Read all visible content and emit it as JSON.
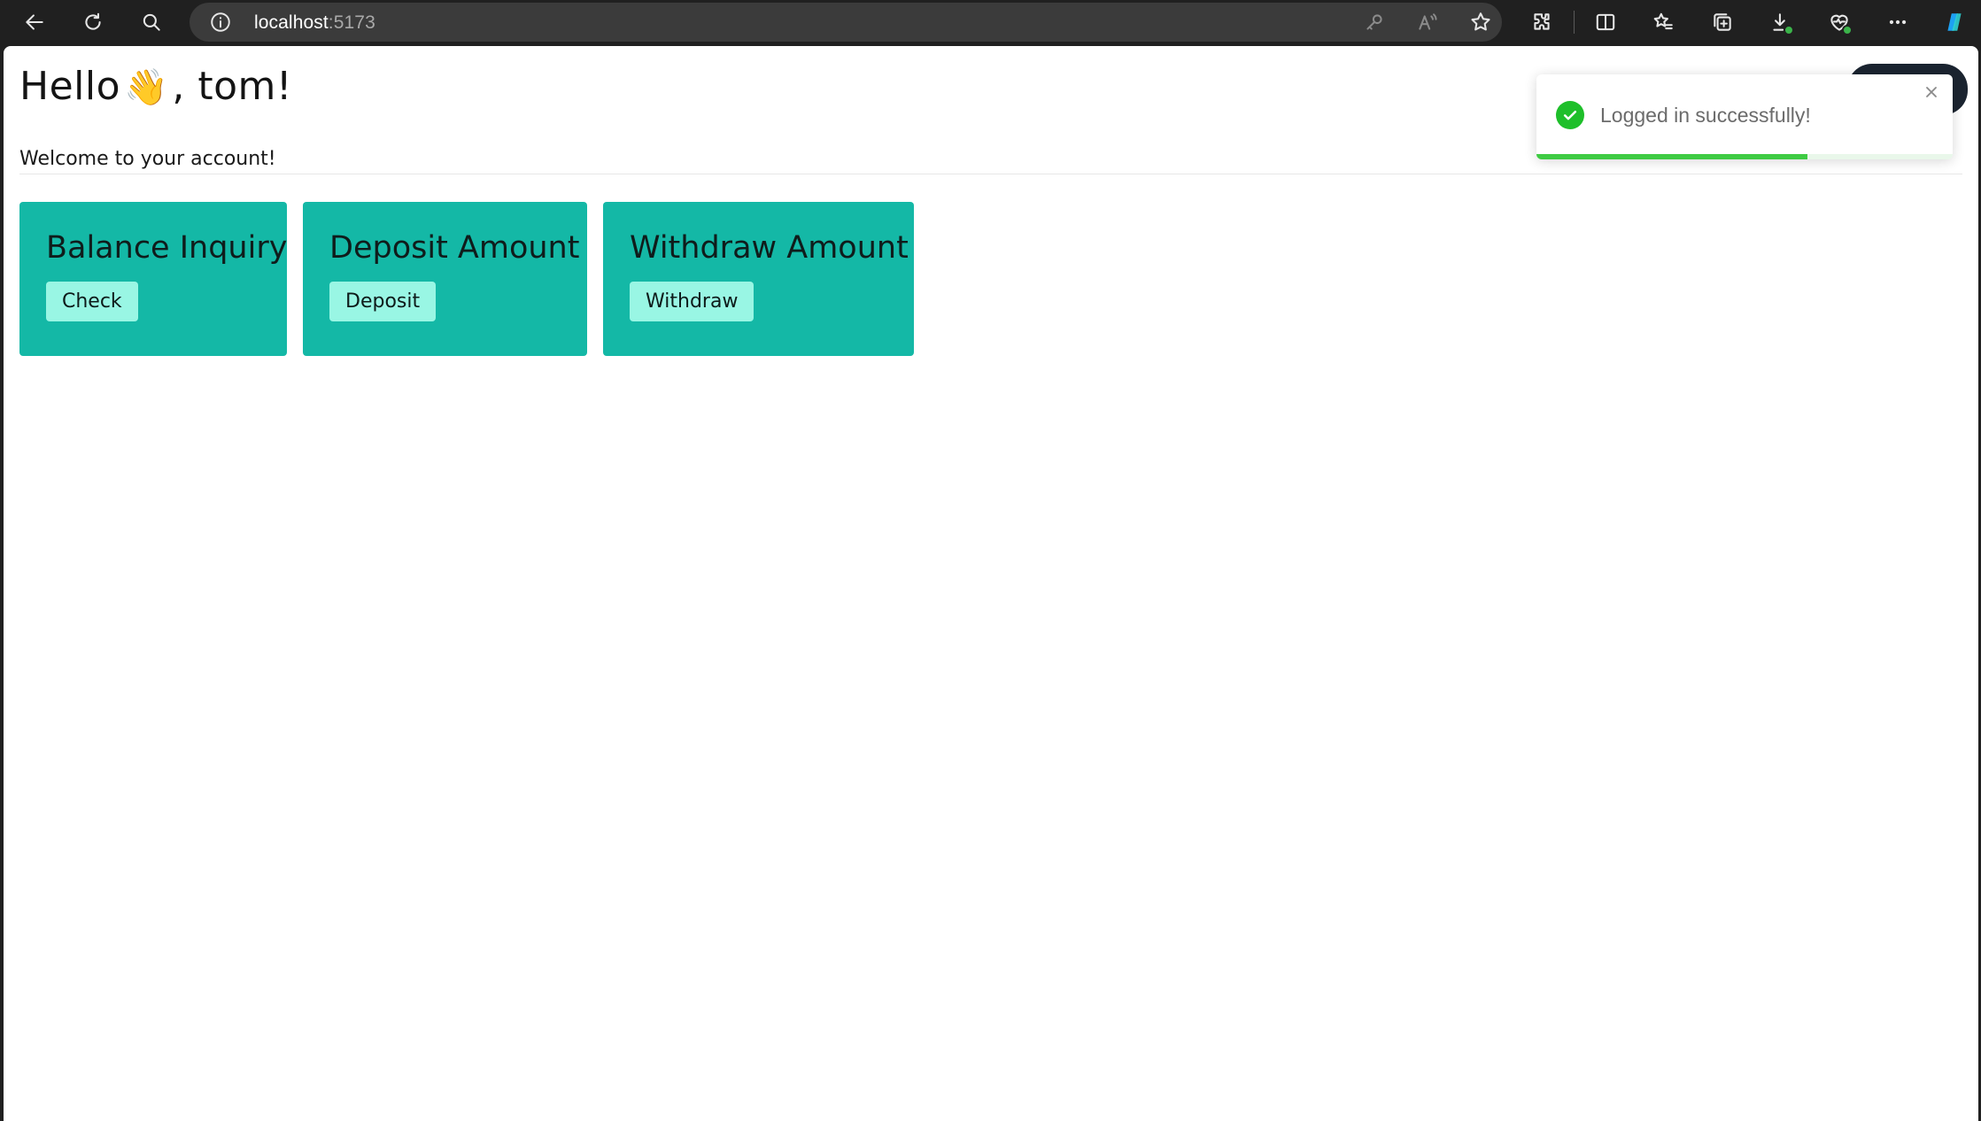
{
  "browser": {
    "url_host": "localhost",
    "url_port": ":5173",
    "icons": [
      "back-icon",
      "refresh-icon",
      "search-icon",
      "info-icon",
      "key-icon",
      "read-aloud-icon",
      "favorite-star-icon",
      "extensions-icon",
      "split-screen-icon",
      "favorites-icon",
      "collections-icon",
      "downloads-icon",
      "browser-essentials-icon",
      "more-icon",
      "copilot-icon"
    ]
  },
  "page": {
    "greeting_prefix": "Hello",
    "wave_emoji": "👋",
    "greeting_suffix": ", tom!",
    "welcome": "Welcome to your account!"
  },
  "cards": [
    {
      "title": "Balance Inquiry",
      "button": "Check"
    },
    {
      "title": "Deposit Amount",
      "button": "Deposit"
    },
    {
      "title": "Withdraw Amount",
      "button": "Withdraw"
    }
  ],
  "toast": {
    "message": "Logged in successfully!",
    "progress": 0.65,
    "accent": "#1ebf2a"
  },
  "colors": {
    "card_bg": "#14b8a6",
    "card_button_bg": "#99f6e4"
  }
}
